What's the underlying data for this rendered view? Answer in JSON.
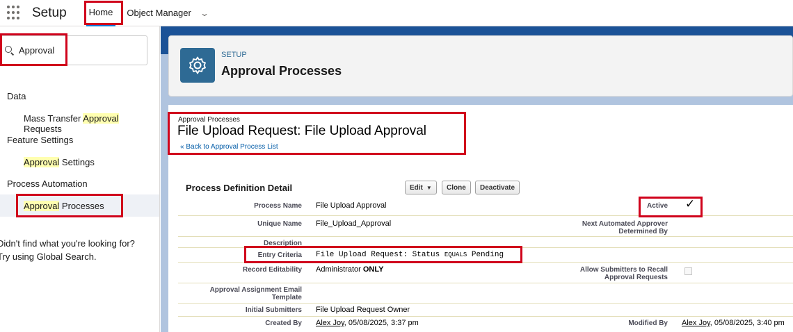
{
  "topnav": {
    "app_name": "Setup",
    "tabs": [
      {
        "label": "Home"
      },
      {
        "label": "Object Manager"
      }
    ]
  },
  "sidebar": {
    "search_value": "Approval",
    "highlight": "Approval",
    "groups": [
      {
        "label": "Data"
      },
      {
        "label": "Feature Settings"
      },
      {
        "label": "Process Automation"
      }
    ],
    "items": [
      {
        "pre": "Mass Transfer ",
        "hl": "Approval",
        "post": " Requests"
      },
      {
        "pre": "",
        "hl": "Approval",
        "post": " Settings"
      },
      {
        "pre": "",
        "hl": "Approval",
        "post": " Processes"
      }
    ],
    "help_line1": "Didn't find what you're looking for?",
    "help_line2": "Try using Global Search."
  },
  "header": {
    "eyebrow": "SETUP",
    "title": "Approval Processes"
  },
  "detail": {
    "breadcrumb": "Approval Processes",
    "title": "File Upload Request: File Upload Approval",
    "back_link": "« Back to Approval Process List",
    "section_title": "Process Definition Detail",
    "buttons": {
      "edit": "Edit",
      "clone": "Clone",
      "deactivate": "Deactivate"
    },
    "fields": {
      "process_name_label": "Process Name",
      "process_name_value": "File Upload Approval",
      "active_label": "Active",
      "unique_name_label": "Unique Name",
      "unique_name_value": "File_Upload_Approval",
      "next_approver_label_1": "Next Automated Approver",
      "next_approver_label_2": "Determined By",
      "description_label": "Description",
      "entry_criteria_label": "Entry Criteria",
      "entry_criteria_pre": "File Upload Request: Status ",
      "entry_criteria_op": "EQUALS",
      "entry_criteria_post": " Pending",
      "record_editability_label": "Record Editability",
      "record_editability_pre": "Administrator ",
      "record_editability_strong": "ONLY",
      "allow_recall_label_1": "Allow Submitters to Recall",
      "allow_recall_label_2": "Approval Requests",
      "email_template_label_1": "Approval Assignment Email",
      "email_template_label_2": "Template",
      "initial_submitters_label": "Initial Submitters",
      "initial_submitters_value": "File Upload Request Owner",
      "created_by_label": "Created By",
      "created_by_name": "Alex Joy",
      "created_by_date": ", 05/08/2025, 3:37 pm",
      "modified_by_label": "Modified By",
      "modified_by_name": "Alex Joy",
      "modified_by_date": ", 05/08/2025, 3:40 pm"
    },
    "active_checked": true,
    "allow_recall_checked": false
  },
  "colors": {
    "brand_blue": "#1b5297",
    "icon_blue": "#2e6a94",
    "annotation_red": "#d0021b",
    "search_highlight": "#ffffb0"
  }
}
